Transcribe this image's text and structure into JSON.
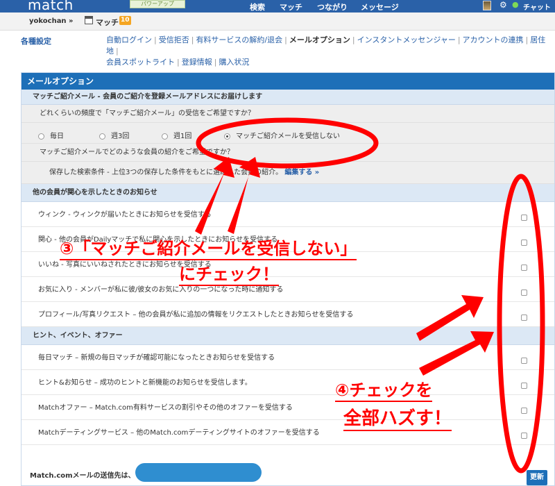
{
  "topbar": {
    "logo": "match",
    "powerup_label": "パワーアップ",
    "nav": [
      "検索",
      "マッチ",
      "つながり",
      "メッセージ"
    ],
    "chat_label": "チャット"
  },
  "userbar": {
    "username": "yokochan »",
    "match_label": "マッチ",
    "match_count": "10"
  },
  "settings": {
    "title": "各種設定",
    "links": [
      {
        "label": "自動ログイン",
        "current": false
      },
      {
        "label": "受信拒否",
        "current": false
      },
      {
        "label": "有料サービスの解約/退会",
        "current": false
      },
      {
        "label": "メールオプション",
        "current": true
      },
      {
        "label": "インスタントメッセンジャー",
        "current": false
      },
      {
        "label": "アカウントの連携",
        "current": false
      },
      {
        "label": "居住地",
        "current": false
      },
      {
        "label": "会員スポットライト",
        "current": false
      },
      {
        "label": "登録情報",
        "current": false
      },
      {
        "label": "購入状況",
        "current": false
      }
    ]
  },
  "panel": {
    "title": "メールオプション",
    "match_intro": {
      "header": "マッチご紹介メール - 会員のご紹介を登録メールアドレスにお届けします",
      "frequency_question": "どれくらいの頻度で「マッチご紹介メール」の受信をご希望ですか？",
      "options": [
        {
          "label": "毎日",
          "selected": false
        },
        {
          "label": "週3回",
          "selected": false
        },
        {
          "label": "週1回",
          "selected": false
        },
        {
          "label": "マッチご紹介メールを受信しない",
          "selected": true
        }
      ],
      "type_question": "マッチご紹介メールでどのような会員の紹介をご希望ですか？",
      "saved_search": "保存した検索条件 - 上位3つの保存した条件をもとに選ばれた会員の紹介。",
      "edit_link": "編集する »"
    },
    "interest": {
      "header": "他の会員が関心を示したときのお知らせ",
      "items": [
        "ウィンク - ウィンクが届いたときにお知らせを受信する",
        "関心 - 他の会員がDailyマッチで私に関心を示したときにお知らせを受信する",
        "いいね - 写真にいいねされたときにお知らせを受信する",
        "お気に入り - メンバーが私に彼/彼女のお気に入りの一つになった時に通知する",
        "プロフィール/写真リクエスト – 他の会員が私に追加の情報をリクエストしたときお知らせを受信する"
      ]
    },
    "hints": {
      "header": "ヒント、イベント、オファー",
      "items": [
        "毎日マッチ – 新規の毎日マッチが確認可能になったときお知らせを受信する",
        "ヒント&お知らせ – 成功のヒントと新機能のお知らせを受信します。",
        "Matchオファー – Match.com有料サービスの割引やその他のオファーを受信する",
        "Matchデーティングサービス – 他のMatch.comデーティングサイトのオファーを受信する"
      ]
    },
    "footer_label": "Match.comメールの送信先は、",
    "update_button": "更新"
  },
  "annotations": {
    "step3_line1": "③「マッチご紹介メールを受信しない」",
    "step3_line2": "にチェック！",
    "step4_line1": "④チェックを",
    "step4_line2": "全部ハズす！",
    "color": "#ff0000"
  },
  "colors": {
    "nav_blue": "#2a61a8",
    "panel_header": "#1d6fb8",
    "sub_header": "#dce8f5"
  }
}
